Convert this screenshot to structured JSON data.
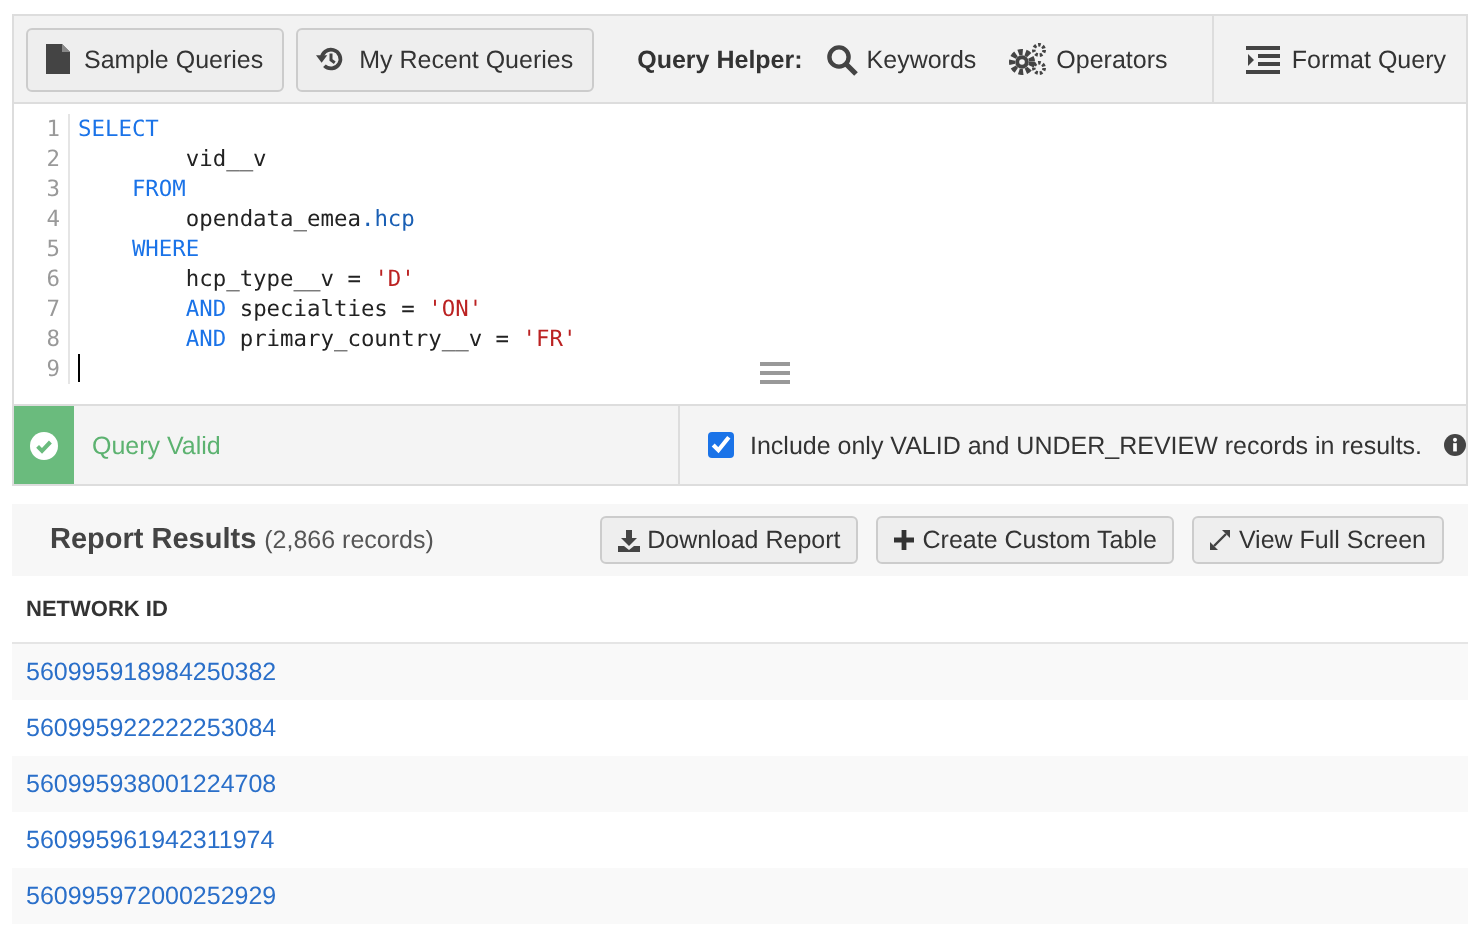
{
  "toolbar": {
    "buttons": [
      {
        "kind": "document",
        "label": "Sample Queries"
      },
      {
        "kind": "history",
        "label": "My Recent Queries"
      }
    ],
    "helper_label": "Query Helper:",
    "helpers": [
      {
        "kind": "search",
        "label": "Keywords"
      },
      {
        "kind": "gears",
        "label": "Operators"
      }
    ],
    "format_button": "Format Query"
  },
  "editor": {
    "lines": [
      {
        "number": "1",
        "tokens": [
          {
            "kind": "keyword",
            "text": "SELECT"
          }
        ]
      },
      {
        "number": "2",
        "tokens": [
          {
            "kind": "plain",
            "text": "        vid__v"
          }
        ]
      },
      {
        "number": "3",
        "tokens": [
          {
            "kind": "keyword",
            "text": "    FROM"
          }
        ]
      },
      {
        "number": "4",
        "tokens": [
          {
            "kind": "plain",
            "text": "        opendata_emea"
          },
          {
            "kind": "table",
            "text": ".hcp"
          }
        ]
      },
      {
        "number": "5",
        "tokens": [
          {
            "kind": "keyword",
            "text": "    WHERE"
          }
        ]
      },
      {
        "number": "6",
        "tokens": [
          {
            "kind": "plain",
            "text": "        hcp_type__v = "
          },
          {
            "kind": "string",
            "text": "'D'"
          }
        ]
      },
      {
        "number": "7",
        "tokens": [
          {
            "kind": "keyword",
            "text": "        AND"
          },
          {
            "kind": "plain",
            "text": " specialties = "
          },
          {
            "kind": "string",
            "text": "'ON'"
          }
        ]
      },
      {
        "number": "8",
        "tokens": [
          {
            "kind": "keyword",
            "text": "        AND"
          },
          {
            "kind": "plain",
            "text": " primary_country__v = "
          },
          {
            "kind": "string",
            "text": "'FR'"
          }
        ]
      },
      {
        "number": "9",
        "cursor": true
      }
    ]
  },
  "status": {
    "valid": true,
    "message": "Query Valid",
    "include_checked": true,
    "include_label": "Include only VALID and UNDER_REVIEW records in results."
  },
  "results": {
    "title": "Report Results",
    "count": "(2,866 records)",
    "buttons": [
      {
        "kind": "download",
        "label": "Download Report"
      },
      {
        "kind": "plus",
        "label": "Create Custom Table"
      },
      {
        "kind": "expand",
        "label": "View Full Screen"
      }
    ],
    "column": "NETWORK ID",
    "rows": [
      "560995918984250382",
      "560995922222253084",
      "560995938001224708",
      "560995961942311974",
      "560995972000252929"
    ]
  }
}
